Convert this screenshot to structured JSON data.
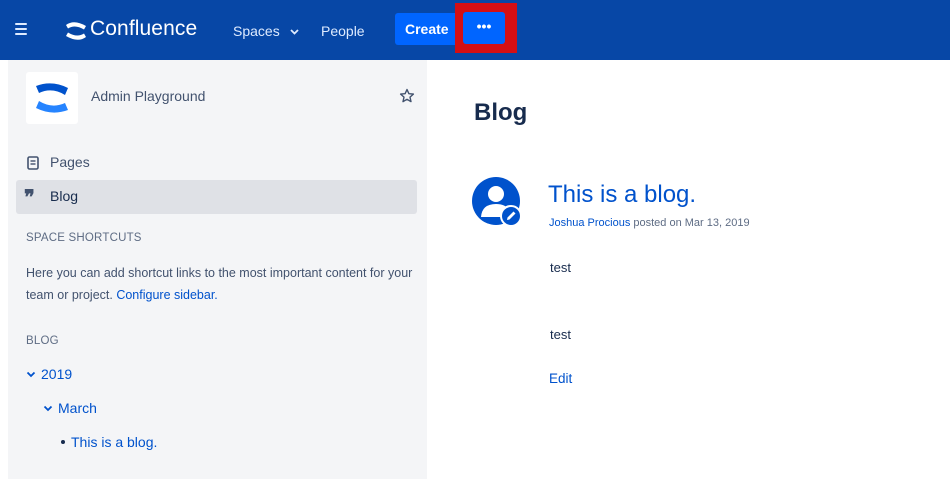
{
  "topbar": {
    "brand": "Confluence",
    "spaces_label": "Spaces",
    "people_label": "People",
    "create_label": "Create",
    "more_label": "•••",
    "icons": [
      "menu-icon",
      "confluence-logo-icon",
      "chevron-down-icon"
    ],
    "highlight_color": "#d40f14",
    "bar_color": "#0747a6",
    "button_color": "#0065ff"
  },
  "sidebar": {
    "space_name": "Admin Playground",
    "nav": [
      {
        "label": "Pages",
        "icon": "pages-icon"
      },
      {
        "label": "Blog",
        "icon": "quote-icon",
        "selected": true
      }
    ],
    "shortcuts_heading": "SPACE SHORTCUTS",
    "shortcuts_text": "Here you can add shortcut links to the most important content for your team or project.",
    "configure_link": "Configure sidebar.",
    "blog_heading": "BLOG",
    "tree": {
      "year": "2019",
      "month": "March",
      "post": "This is a blog."
    }
  },
  "main": {
    "title": "Blog",
    "post": {
      "title": "This is a blog.",
      "author": "Joshua Procious",
      "posted_text": "posted on Mar 13, 2019",
      "body": [
        "test",
        "test"
      ],
      "edit_label": "Edit"
    }
  }
}
